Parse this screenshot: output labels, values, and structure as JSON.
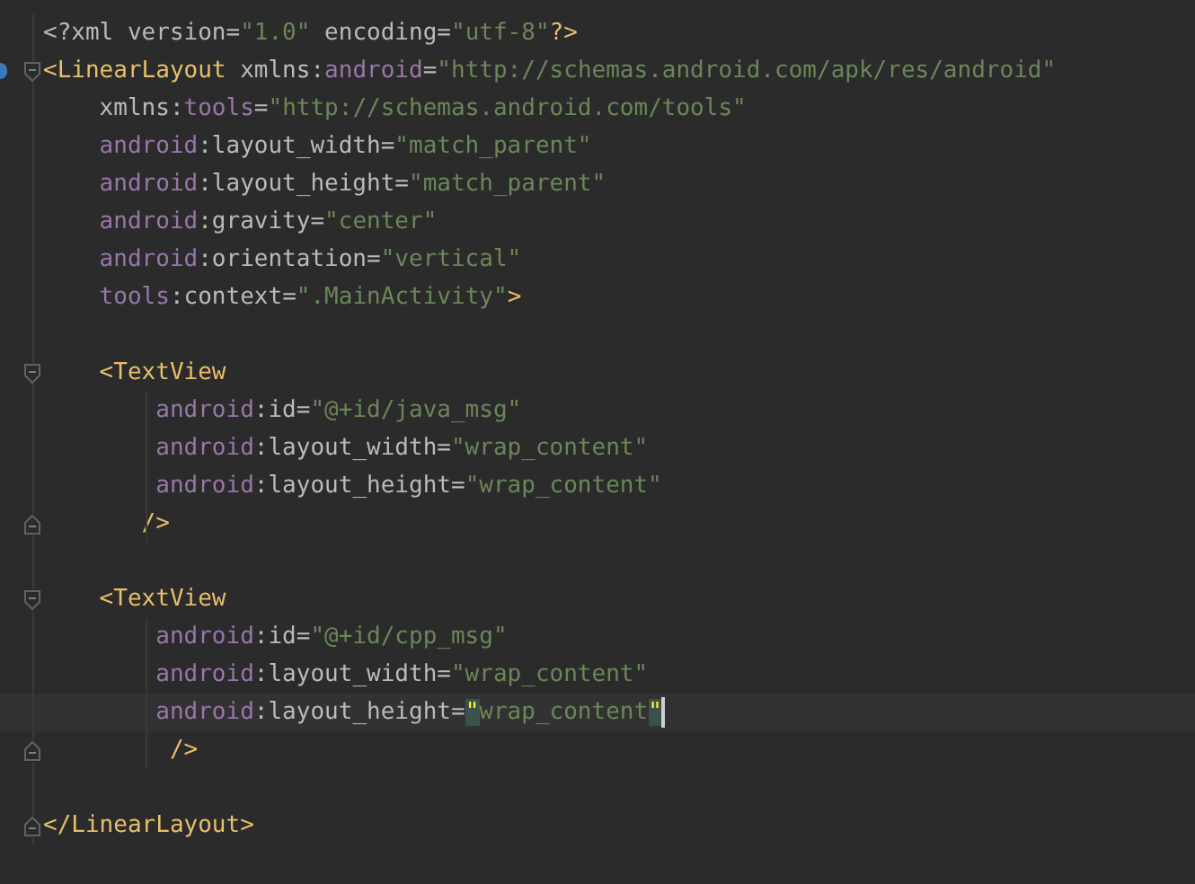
{
  "editor": {
    "lines": [
      {
        "tokens": [
          {
            "kind": "attr",
            "text": "<?xml version="
          },
          {
            "kind": "value",
            "text": "\"1.0\""
          },
          {
            "kind": "attr",
            "text": " encoding="
          },
          {
            "kind": "value",
            "text": "\"utf-8\""
          },
          {
            "kind": "tag",
            "text": "?>"
          }
        ]
      },
      {
        "fold_start": true,
        "marker": true,
        "tokens": [
          {
            "kind": "tag",
            "text": "<LinearLayout"
          },
          {
            "kind": "attr",
            "text": " xmlns:"
          },
          {
            "kind": "ns",
            "text": "android"
          },
          {
            "kind": "attr",
            "text": "="
          },
          {
            "kind": "value",
            "text": "\"http://schemas.android.com/apk/res/android\""
          }
        ]
      },
      {
        "tokens": [
          {
            "kind": "attr",
            "text": "    xmlns:"
          },
          {
            "kind": "ns",
            "text": "tools"
          },
          {
            "kind": "attr",
            "text": "="
          },
          {
            "kind": "value",
            "text": "\"http://schemas.android.com/tools\""
          }
        ]
      },
      {
        "tokens": [
          {
            "kind": "ns",
            "text": "    android"
          },
          {
            "kind": "attr",
            "text": ":layout_width="
          },
          {
            "kind": "value",
            "text": "\"match_parent\""
          }
        ]
      },
      {
        "tokens": [
          {
            "kind": "ns",
            "text": "    android"
          },
          {
            "kind": "attr",
            "text": ":layout_height="
          },
          {
            "kind": "value",
            "text": "\"match_parent\""
          }
        ]
      },
      {
        "tokens": [
          {
            "kind": "ns",
            "text": "    android"
          },
          {
            "kind": "attr",
            "text": ":gravity="
          },
          {
            "kind": "value",
            "text": "\"center\""
          }
        ]
      },
      {
        "tokens": [
          {
            "kind": "ns",
            "text": "    android"
          },
          {
            "kind": "attr",
            "text": ":orientation="
          },
          {
            "kind": "value",
            "text": "\"vertical\""
          }
        ]
      },
      {
        "tokens": [
          {
            "kind": "ns",
            "text": "    tools"
          },
          {
            "kind": "attr",
            "text": ":context="
          },
          {
            "kind": "value",
            "text": "\".MainActivity\""
          },
          {
            "kind": "tag",
            "text": ">"
          }
        ]
      },
      {
        "gap_before": true,
        "fold_start": true,
        "tokens": [
          {
            "kind": "tag",
            "text": "    <TextView"
          }
        ]
      },
      {
        "guide": true,
        "tokens": [
          {
            "kind": "ns",
            "text": "        android"
          },
          {
            "kind": "attr",
            "text": ":id="
          },
          {
            "kind": "value",
            "text": "\"@+id/java_msg\""
          }
        ]
      },
      {
        "guide": true,
        "tokens": [
          {
            "kind": "ns",
            "text": "        android"
          },
          {
            "kind": "attr",
            "text": ":layout_width="
          },
          {
            "kind": "value",
            "text": "\"wrap_content\""
          }
        ]
      },
      {
        "guide": true,
        "tokens": [
          {
            "kind": "ns",
            "text": "        android"
          },
          {
            "kind": "attr",
            "text": ":layout_height="
          },
          {
            "kind": "value",
            "text": "\"wrap_content\""
          }
        ]
      },
      {
        "fold_end": true,
        "guide": true,
        "tokens": [
          {
            "kind": "tag",
            "text": "       />"
          }
        ]
      },
      {
        "gap_before": true,
        "fold_start": true,
        "tokens": [
          {
            "kind": "tag",
            "text": "    <TextView"
          }
        ]
      },
      {
        "guide": true,
        "tokens": [
          {
            "kind": "ns",
            "text": "        android"
          },
          {
            "kind": "attr",
            "text": ":id="
          },
          {
            "kind": "value",
            "text": "\"@+id/cpp_msg\""
          }
        ]
      },
      {
        "guide": true,
        "tokens": [
          {
            "kind": "ns",
            "text": "        android"
          },
          {
            "kind": "attr",
            "text": ":layout_width="
          },
          {
            "kind": "value",
            "text": "\"wrap_content\""
          }
        ]
      },
      {
        "guide": true,
        "current": true,
        "tokens": [
          {
            "kind": "ns",
            "text": "        android"
          },
          {
            "kind": "attr",
            "text": ":layout_height="
          },
          {
            "kind": "value",
            "text": "\"",
            "matched": true
          },
          {
            "kind": "value",
            "text": "wrap_content"
          },
          {
            "kind": "value",
            "text": "\"",
            "matched": true
          }
        ]
      },
      {
        "fold_end": true,
        "guide": true,
        "tokens": [
          {
            "kind": "tag",
            "text": "         />"
          }
        ]
      },
      {
        "gap_before": true,
        "fold_end": true,
        "tokens": [
          {
            "kind": "tag",
            "text": "</LinearLayout>"
          }
        ]
      }
    ]
  }
}
